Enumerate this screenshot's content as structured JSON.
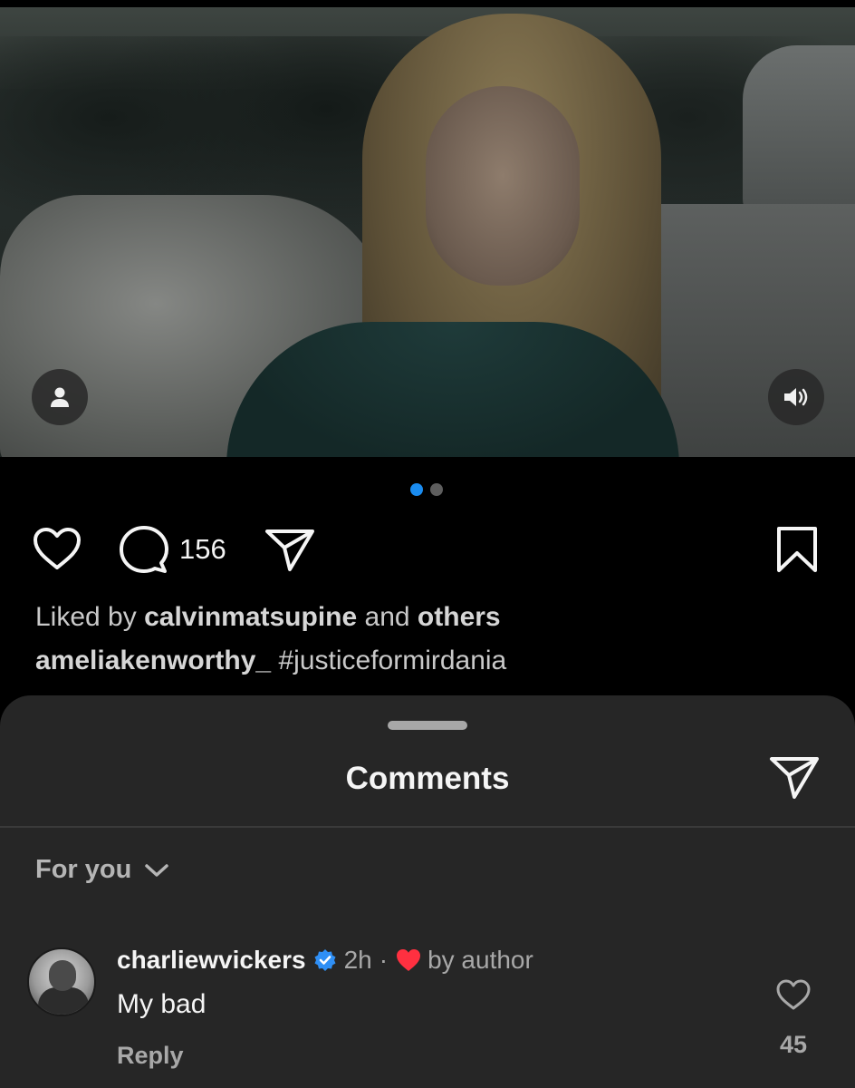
{
  "post": {
    "comment_count": "156",
    "liked_by_prefix": "Liked by",
    "liked_by_user": "calvinmatsupine",
    "liked_by_and": "and",
    "liked_by_others": "others",
    "caption_user": "ameliakenworthy_",
    "caption_text": "#justiceformirdania",
    "carousel": {
      "count": 2,
      "active": 1
    }
  },
  "comments_sheet": {
    "title": "Comments",
    "filter_label": "For you",
    "comments": [
      {
        "username": "charliewvickers",
        "verified": true,
        "time": "2h",
        "separator": "·",
        "author_liked_label": "by author",
        "text": "My bad",
        "reply_label": "Reply",
        "like_count": "45"
      }
    ]
  },
  "icons": {
    "tag": "person-tag-icon",
    "sound": "speaker-icon",
    "like": "heart-outline-icon",
    "comment": "comment-bubble-icon",
    "share": "paper-plane-icon",
    "save": "bookmark-icon",
    "chevron": "chevron-down-icon",
    "verified": "verified-badge-icon",
    "author_heart": "red-heart-icon"
  },
  "colors": {
    "background": "#000000",
    "sheet": "#262626",
    "accent_dot": "#1a8cf0",
    "verified": "#2f8ff5",
    "heart": "#ff3040",
    "muted_text": "#a8a8a8"
  }
}
